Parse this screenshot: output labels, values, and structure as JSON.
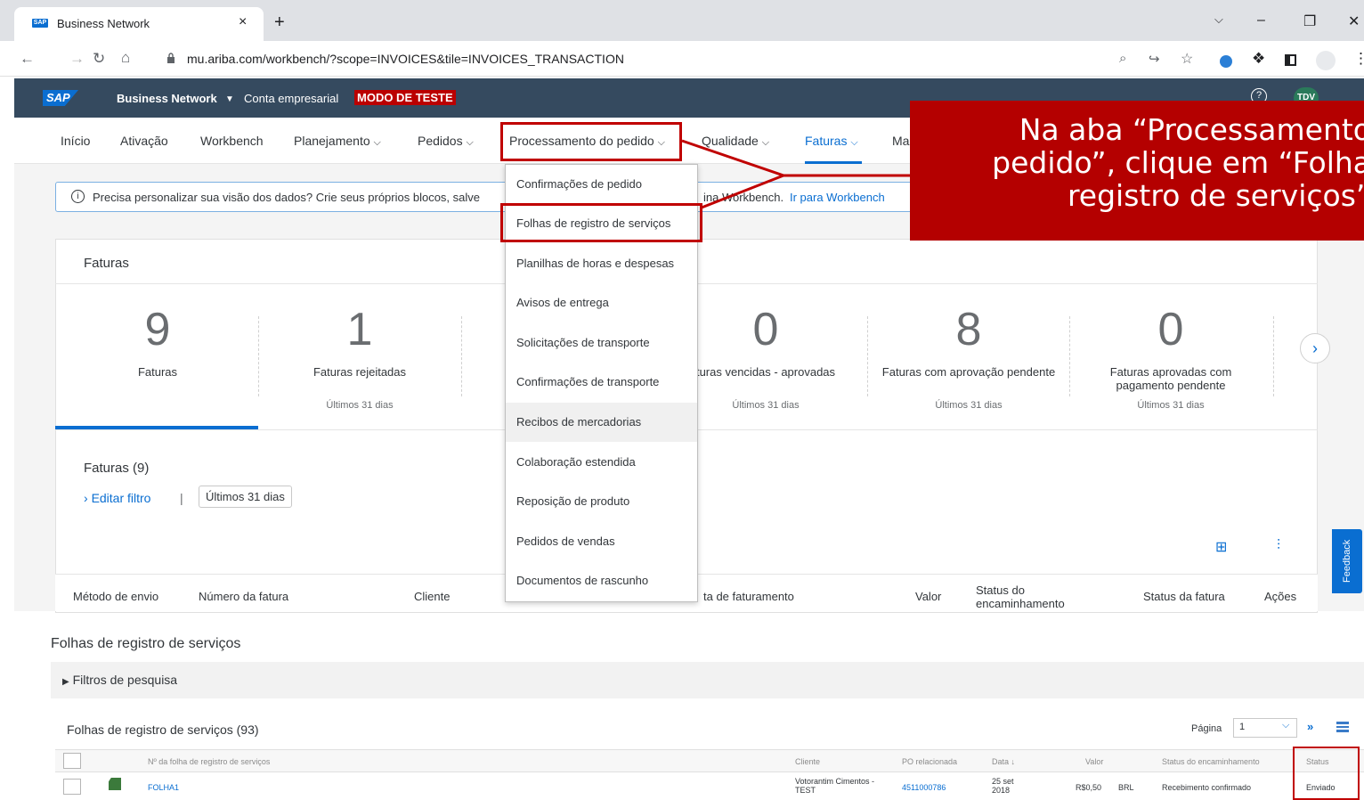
{
  "browser": {
    "tab_title": "Business Network",
    "tab_close": "×",
    "new_tab": "+",
    "url": "mu.ariba.com/workbench/?scope=INVOICES&tile=INVOICES_TRANSACTION"
  },
  "header": {
    "logo": "SAP",
    "product": "Business Network",
    "account": "Conta empresarial",
    "test_mode": "MODO DE TESTE",
    "help": "?",
    "avatar": "TDV"
  },
  "nav": {
    "items": [
      "Início",
      "Ativação",
      "Workbench",
      "Planejamento",
      "Pedidos",
      "Processamento do pedido",
      "Qualidade",
      "Faturas",
      "Ma"
    ],
    "chevron": "⌵"
  },
  "info_banner": {
    "text_start": "Precisa personalizar sua visão dos dados? Crie seus próprios blocos, salve",
    "text_end": "ina Workbench.",
    "link": "Ir para Workbench"
  },
  "invoices_card": {
    "title": "Faturas",
    "tiles": [
      {
        "value": "9",
        "label": "Faturas",
        "sub": ""
      },
      {
        "value": "1",
        "label": "Faturas rejeitadas",
        "sub": "Últimos 31 dias"
      },
      {
        "value": "0",
        "label": "turas vencidas - aprovadas",
        "sub": "Últimos 31 dias"
      },
      {
        "value": "8",
        "label": "Faturas com aprovação pendente",
        "sub": "Últimos 31 dias"
      },
      {
        "value": "0",
        "label": "Faturas aprovadas com pagamento pendente",
        "sub": "Últimos 31 dias"
      }
    ],
    "list_title": "Faturas (9)",
    "edit_filter": "Editar filtro",
    "filter_chip": "Últimos 31 dias",
    "columns": [
      "Método de envio",
      "Número da fatura",
      "Cliente",
      "ta de faturamento",
      "Valor",
      "Status do encaminhamento",
      "Status da fatura",
      "Ações"
    ],
    "feedback": "Feedback"
  },
  "dropdown": {
    "items": [
      "Confirmações de pedido",
      "Folhas de registro de serviços",
      "Planilhas de horas e despesas",
      "Avisos de entrega",
      "Solicitações de transporte",
      "Confirmações de transporte",
      "Recibos de mercadorias",
      "Colaboração estendida",
      "Reposição de produto",
      "Pedidos de vendas",
      "Documentos de rascunho"
    ]
  },
  "callout": {
    "lines": [
      "Na aba “Processamento",
      "pedido”, clique em “Folha",
      "registro de serviços”"
    ],
    "color": "#b40000"
  },
  "ses": {
    "page_title": "Folhas de registro de serviços",
    "search_filters": "Filtros de pesquisa",
    "table_title": "Folhas de registro de serviços (93)",
    "pager_label": "Página",
    "pager_value": "1",
    "columns": [
      "Nº da folha de registro de serviços",
      "Cliente",
      "PO relacionada",
      "Data",
      "Valor",
      "Status do encaminhamento",
      "Status"
    ],
    "row": {
      "number": "FOLHA1",
      "customer": "Votorantim Cimentos - TEST",
      "po": "4511000786",
      "date": "25 set 2018",
      "amount": "R$0,50",
      "currency": "BRL",
      "routing": "Recebimento confirmado",
      "status": "Enviado"
    }
  }
}
